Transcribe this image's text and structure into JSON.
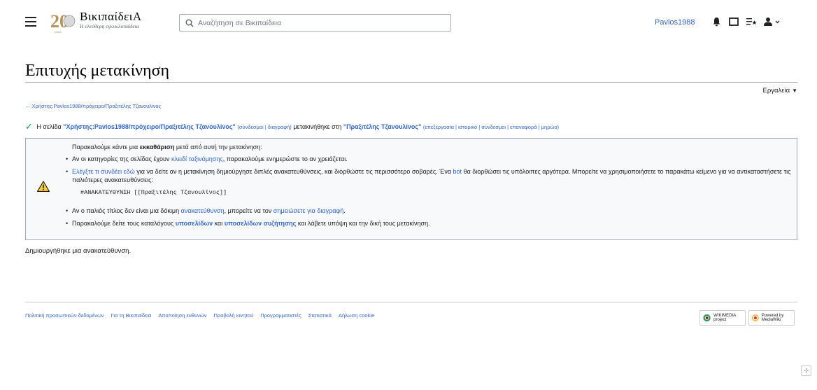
{
  "header": {
    "site_name": "ΒικιπαίδειΑ",
    "site_tagline": "Η ελεύθερη εγκυκλοπαίδεια",
    "logo_text": "20",
    "search_placeholder": "Αναζήτηση σε Βικιπαίδεια",
    "username": "Pavlos1988"
  },
  "page": {
    "title": "Επιτυχής μετακίνηση",
    "tools_label": "Εργαλεία",
    "backlink": "← Χρήστης:Pavlos1988/πρόχειρο/Πραξιτέλης Τζανουλίνος"
  },
  "success": {
    "prefix": "Η σελίδα",
    "old_title": "\"Χρήστης:Pavlos1988/πρόχειρο/Πραξιτέλης Τζανουλίνος\"",
    "old_links": "(σύνδεσμοι | διαγραφή)",
    "middle": "μετακινήθηκε στη",
    "new_title": "\"Πραξιτέλης Τζανουλίνος\"",
    "new_links": "(επεξεργασία | ιστορικό | σύνδεσμοι | επαναφορά | μηρώο)"
  },
  "notice": {
    "intro_a": "Παρακαλούμε κάντε μια",
    "intro_bold": "εκκαθάριση",
    "intro_b": "μετά από αυτή την μετακίνηση:",
    "b1_a": "Αν οι κατηγορίες της σελίδας έχουν",
    "b1_link": "κλειδί ταξινόμησης",
    "b1_b": ", παρακαλούμε ενημερώστε το αν χρειάζεται.",
    "b2_link": "Ελέγξτε τι συνδέει εδώ",
    "b2_a": "για να δείτε αν η μετακίνηση δημιούργησε διπλές ανακατευθύνσεις, και διορθώστε τις περισσότερο σοβαρές. Ένα",
    "b2_bot": "bot",
    "b2_b": "θα διορθώσει τις υπόλοιπες αργότερα. Μπορείτε να χρησιμοποιήσετε το παρακάτω κείμενο για να αντικαταστήσετε τις παλιότερες ανακατευθύνσεις:",
    "code": "#ΑΝΑΚΑΤΕΥΘΥΝΣΗ [[Πραξιτέλης Τζανουλίνος]]",
    "b3_a": "Αν ο παλιός τίτλος δεν είναι μια δόκιμη",
    "b3_link1": "ανακατεύθυνση",
    "b3_b": ", μπορείτε να τον",
    "b3_link2": "σημειώσετε για διαγραφή",
    "b3_c": ".",
    "b4_a": "Παρακαλούμε δείτε τους καταλόγους",
    "b4_link1": "υποσελίδων",
    "b4_b": "και",
    "b4_link2": "υποσελίδων συζήτησης",
    "b4_c": "και λάβετε υπόψη και την δική τους μετακίνηση."
  },
  "created_text": "Δημιουργήθηκε μια ανακατεύθυνση.",
  "footer": {
    "links": [
      "Πολιτική προσωπικών δεδομένων",
      "Για τη Βικιπαίδεια",
      "Αποποίηση ευθυνών",
      "Προβολή κινητού",
      "Προγραμματιστές",
      "Στατιστικά",
      "Δήλωση cookie"
    ],
    "wikimedia_badge": "WIKIMEDIA project",
    "mediawiki_badge": "Powered by MediaWiki"
  },
  "colors": {
    "link": "#3366cc",
    "success": "#14866d",
    "warning": "#fc3",
    "box_bg": "#f8f9fa"
  }
}
